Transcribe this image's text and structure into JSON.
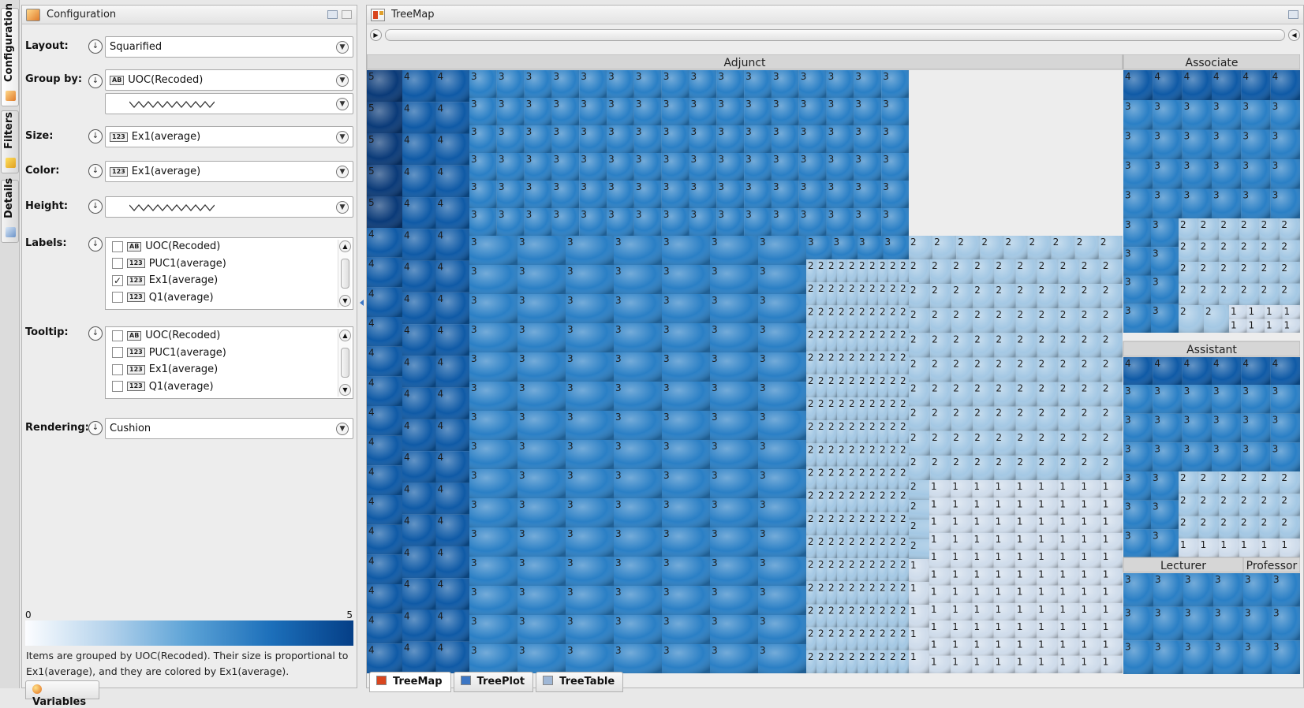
{
  "side_tabs": [
    "Configuration",
    "Filters",
    "Details"
  ],
  "config": {
    "title": "Configuration",
    "layout_label": "Layout:",
    "layout_value": "Squarified",
    "groupby_label": "Group by:",
    "groupby_value": "UOC(Recoded)",
    "size_label": "Size:",
    "size_value": "Ex1(average)",
    "color_label": "Color:",
    "color_value": "Ex1(average)",
    "height_label": "Height:",
    "labels_label": "Labels:",
    "labels_items": [
      {
        "badge": "AB",
        "text": "UOC(Recoded)",
        "checked": false
      },
      {
        "badge": "123",
        "text": "PUC1(average)",
        "checked": false
      },
      {
        "badge": "123",
        "text": "Ex1(average)",
        "checked": true
      },
      {
        "badge": "123",
        "text": "Q1(average)",
        "checked": false
      }
    ],
    "tooltip_label": "Tooltip:",
    "tooltip_items": [
      {
        "badge": "AB",
        "text": "UOC(Recoded)",
        "checked": false
      },
      {
        "badge": "123",
        "text": "PUC1(average)",
        "checked": false
      },
      {
        "badge": "123",
        "text": "Ex1(average)",
        "checked": false
      },
      {
        "badge": "123",
        "text": "Q1(average)",
        "checked": false
      }
    ],
    "rendering_label": "Rendering:",
    "rendering_value": "Cushion",
    "legend_min": "0",
    "legend_max": "5",
    "legend_desc": "Items are grouped by UOC(Recoded). Their size is proportional to Ex1(average), and they are colored by Ex1(average).",
    "bottom_tab": "Variables"
  },
  "treemap": {
    "title": "TreeMap",
    "tabs": [
      "TreeMap",
      "TreePlot",
      "TreeTable"
    ],
    "groups": {
      "adjunct": "Adjunct",
      "associate": "Associate",
      "assistant": "Assistant",
      "lecturer": "Lecturer",
      "professor": "Professor"
    }
  }
}
